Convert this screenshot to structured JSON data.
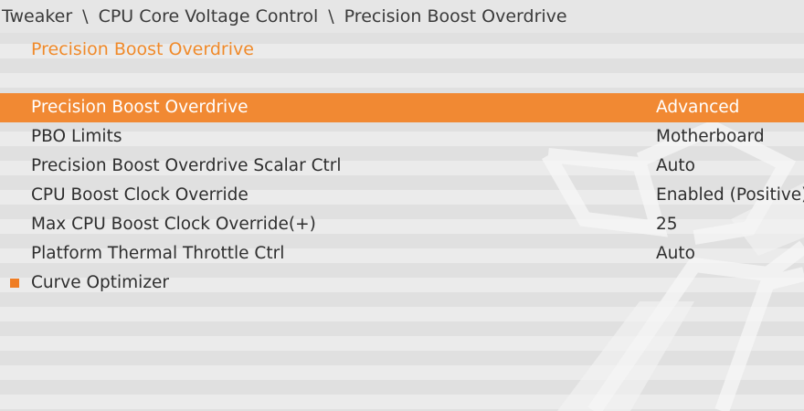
{
  "breadcrumb": [
    "Tweaker",
    "CPU Core Voltage Control",
    "Precision Boost Overdrive"
  ],
  "breadcrumb_separator": "\\",
  "page_title": "Precision Boost Overdrive",
  "accent_color": "#f18933",
  "menu": [
    {
      "label": "Precision Boost Overdrive",
      "value": "Advanced",
      "selected": true
    },
    {
      "label": "PBO Limits",
      "value": "Motherboard"
    },
    {
      "label": "Precision Boost Overdrive Scalar Ctrl",
      "value": "Auto"
    },
    {
      "label": "CPU Boost Clock Override",
      "value": "Enabled (Positive)"
    },
    {
      "label": "Max CPU Boost Clock Override(+)",
      "value": "25"
    },
    {
      "label": "Platform Thermal Throttle Ctrl",
      "value": "Auto"
    },
    {
      "label": "Curve Optimizer",
      "submenu": true,
      "icon": "square-bullet-icon"
    }
  ]
}
